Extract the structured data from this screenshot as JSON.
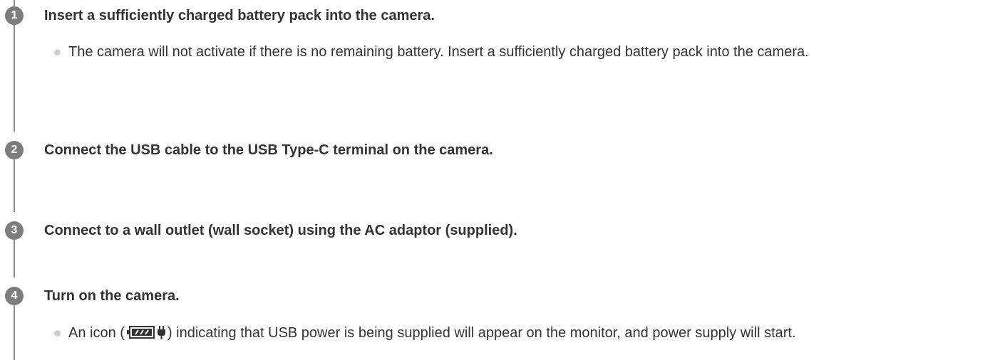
{
  "steps": [
    {
      "number": "1",
      "title": "Insert a sufficiently charged battery pack into the camera.",
      "note": "The camera will not activate if there is no remaining battery. Insert a sufficiently charged battery pack into the camera."
    },
    {
      "number": "2",
      "title": "Connect the USB cable to the USB Type-C terminal on the camera."
    },
    {
      "number": "3",
      "title": "Connect to a wall outlet (wall socket) using the AC adaptor (supplied)."
    },
    {
      "number": "4",
      "title": "Turn on the camera.",
      "note_before_icon": "An icon (",
      "note_after_icon": ") indicating that USB power is being supplied will appear on the monitor, and power supply will start.",
      "icon": "usb-power-supply-icon"
    }
  ],
  "colors": {
    "text": "#333333",
    "step_circle": "#7d7d7d",
    "line": "#8c8c8c",
    "bullet": "#cfcfcf"
  }
}
